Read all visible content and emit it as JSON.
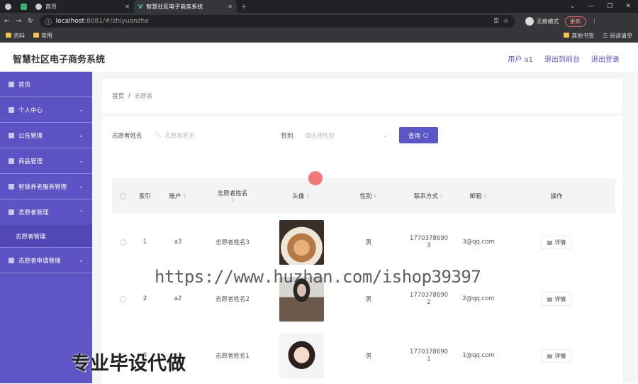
{
  "browser": {
    "tabs": [
      {
        "label": ""
      },
      {
        "label": ""
      },
      {
        "label": "首页"
      },
      {
        "label": "智慧社区电子商务系统"
      }
    ],
    "url_host": "localhost",
    "url_rest": ":8081/#/zhiyuanzhe",
    "incognito_label": "无痕模式",
    "update_label": "更新",
    "bookmarks": [
      {
        "label": "资料"
      },
      {
        "label": "常用"
      }
    ],
    "bookmarks_right": [
      {
        "label": "其他书签"
      },
      {
        "label": "阅读清单"
      }
    ]
  },
  "header": {
    "title": "智慧社区电子商务系统",
    "user": "用户 a1",
    "back": "退出到前台",
    "logout": "退出登录"
  },
  "sidebar": {
    "items": [
      {
        "label": "首页",
        "icon": "home-icon"
      },
      {
        "label": "个人中心",
        "icon": "user-icon"
      },
      {
        "label": "公告管理",
        "icon": "notice-icon"
      },
      {
        "label": "商品管理",
        "icon": "goods-icon"
      },
      {
        "label": "智慧养老服务管理",
        "icon": "service-icon"
      },
      {
        "label": "志愿者管理",
        "icon": "volunteer-icon"
      },
      {
        "label": "志愿者申请管理",
        "icon": "apply-icon"
      }
    ],
    "sub": "志愿者管理"
  },
  "breadcrumb": {
    "home": "首页",
    "sep": "/",
    "current": "志愿者"
  },
  "search": {
    "name_label": "志愿者姓名",
    "name_placeholder": "志愿者姓名",
    "sex_label": "性别",
    "sex_placeholder": "请选择性别",
    "button": "查询"
  },
  "table": {
    "headers": [
      "索引",
      "账户",
      "志愿者姓名",
      "头像",
      "性别",
      "联系方式",
      "邮箱",
      "操作"
    ],
    "rows": [
      {
        "index": "1",
        "account": "a3",
        "name": "志愿者姓名3",
        "sex": "男",
        "phone": "17703786903",
        "email": "3@qq.com",
        "action": "详情"
      },
      {
        "index": "2",
        "account": "a2",
        "name": "志愿者姓名2",
        "sex": "男",
        "phone": "17703786902",
        "email": "2@qq.com",
        "action": "详情"
      },
      {
        "index": "3",
        "account": "a1",
        "name": "志愿者姓名1",
        "sex": "男",
        "phone": "17703786901",
        "email": "1@qq.com",
        "action": "详情"
      }
    ]
  },
  "watermark": "https://www.huzhan.com/ishop39397",
  "overlay": "专业毕设代做"
}
